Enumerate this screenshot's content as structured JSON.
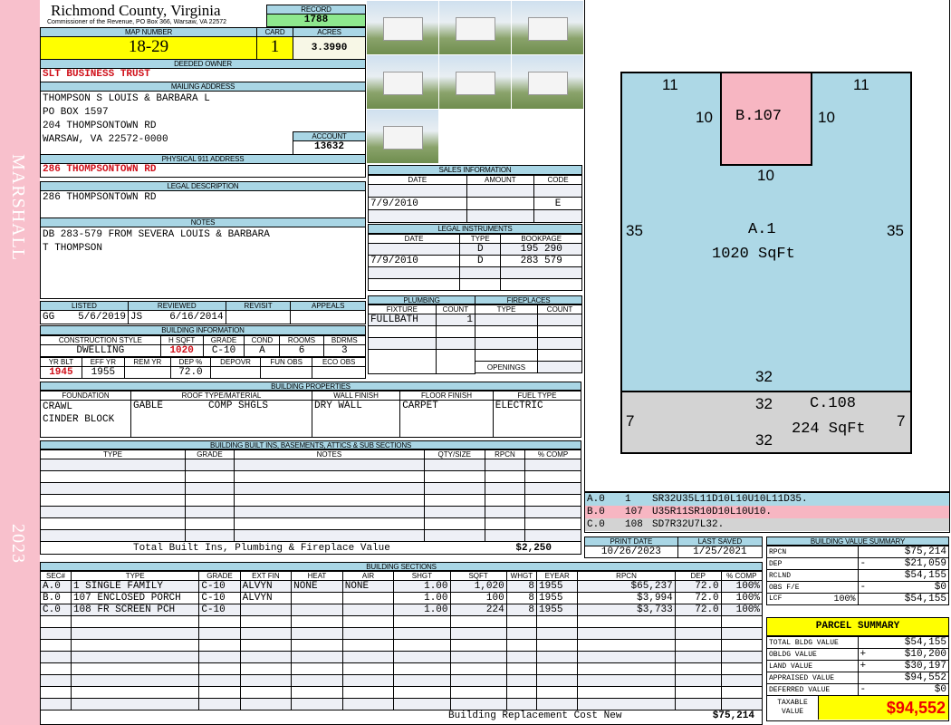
{
  "side": {
    "district": "MARSHALL",
    "year": "2023"
  },
  "header": {
    "county": "Richmond County, Virginia",
    "subtitle": "Commissioner of the Revenue, PO Box 366, Warsaw, VA 22572",
    "record_label": "RECORD",
    "record": "1788",
    "map_label": "MAP NUMBER",
    "map": "18-29",
    "card_label": "CARD",
    "card": "1",
    "acres_label": "ACRES",
    "acres": "3.3990"
  },
  "owner": {
    "label": "DEEDED OWNER",
    "value": "SLT BUSINESS TRUST"
  },
  "mailing": {
    "label": "MAILING ADDRESS",
    "lines": [
      "THOMPSON S LOUIS & BARBARA L",
      "PO BOX 1597",
      "204 THOMPSONTOWN RD",
      "WARSAW, VA 22572-0000"
    ],
    "account_label": "ACCOUNT",
    "account": "13632"
  },
  "physical": {
    "label": "PHYSICAL 911 ADDRESS",
    "value": "286 THOMPSONTOWN RD"
  },
  "legal": {
    "label": "LEGAL DESCRIPTION",
    "value": "286 THOMPSONTOWN RD"
  },
  "notes": {
    "label": "NOTES",
    "lines": [
      "DB 283-579 FROM SEVERA LOUIS & BARBARA",
      "T THOMPSON"
    ]
  },
  "sales": {
    "label": "SALES INFORMATION",
    "cols": [
      "DATE",
      "AMOUNT",
      "CODE"
    ],
    "rows": [
      [
        "",
        "",
        ""
      ],
      [
        "7/9/2010",
        "",
        "E"
      ],
      [
        "",
        "",
        ""
      ]
    ]
  },
  "instruments": {
    "label": "LEGAL INSTRUMENTS",
    "cols": [
      "DATE",
      "TYPE",
      "BOOKPAGE"
    ],
    "rows": [
      [
        "",
        "D",
        "195 290"
      ],
      [
        "7/9/2010",
        "D",
        "283 579"
      ],
      [
        "",
        "",
        ""
      ],
      [
        "",
        "",
        ""
      ]
    ]
  },
  "review": {
    "cols": [
      "LISTED",
      "REVIEWED",
      "REVISIT",
      "APPEALS"
    ],
    "listed_by": "GG",
    "listed": "5/6/2019",
    "reviewed_by": "JS",
    "reviewed": "6/16/2014"
  },
  "building": {
    "label": "BUILDING INFORMATION",
    "cols1": [
      "CONSTRUCTION STYLE",
      "H SQFT",
      "GRADE",
      "COND",
      "ROOMS",
      "BDRMS"
    ],
    "vals1": [
      "DWELLING",
      "1020",
      "C-10",
      "A",
      "6",
      "3"
    ],
    "cols2": [
      "YR BLT",
      "EFF YR",
      "REM YR",
      "DEP %",
      "DEPOVR",
      "FUN OBS",
      "ECO OBS"
    ],
    "vals2": [
      "1945",
      "1955",
      "",
      "72.0",
      "",
      "",
      ""
    ]
  },
  "plumbing": {
    "label": "PLUMBING",
    "cols": [
      "FIXTURE",
      "COUNT"
    ],
    "rows": [
      [
        "FULLBATH",
        "1"
      ]
    ]
  },
  "fireplaces": {
    "label": "FIREPLACES",
    "cols": [
      "TYPE",
      "COUNT"
    ],
    "openings": "OPENINGS"
  },
  "properties": {
    "label": "BUILDING PROPERTIES",
    "cols": [
      "FOUNDATION",
      "ROOF TYPE/MATERIAL",
      "WALL FINISH",
      "FLOOR FINISH",
      "FUEL TYPE"
    ],
    "foundation": [
      "CRAWL",
      "CINDER BLOCK"
    ],
    "roof_type": "GABLE",
    "roof_material": "COMP SHGLS",
    "wall": "DRY WALL",
    "floor": "CARPET",
    "fuel": "ELECTRIC"
  },
  "builtins": {
    "label": "BUILDING BUILT INS, BASEMENTS, ATTICS & SUB SECTIONS",
    "cols": [
      "TYPE",
      "GRADE",
      "NOTES",
      "QTY/SIZE",
      "RPCN",
      "% COMP"
    ],
    "total_label": "Total Built Ins, Plumbing & Fireplace Value",
    "total": "$2,250"
  },
  "sketch": {
    "a_label": "A.1",
    "a_area": "1020 SqFt",
    "b_label": "B.107",
    "c_label": "C.108",
    "c_area": "224 SqFt",
    "dims": {
      "top_left": "11",
      "top_right": "11",
      "b_left": "10",
      "b_right": "10",
      "b_bottom": "10",
      "a_left": "35",
      "a_right": "35",
      "a_bottom": "32",
      "c_top": "32",
      "c_bottom": "32",
      "c_left": "7",
      "c_right": "7"
    },
    "colors": {
      "a": "#add8e6",
      "b": "#f7b6c2",
      "c": "#d3d3d3"
    }
  },
  "codes": [
    {
      "sec": "A.0",
      "code": "1",
      "path": "SR32U35L11D10L10U10L11D35."
    },
    {
      "sec": "B.0",
      "code": "107",
      "path": "U35R11SR10D10L10U10."
    },
    {
      "sec": "C.0",
      "code": "108",
      "path": "SD7R32U7L32."
    }
  ],
  "dates": {
    "print_label": "PRINT DATE",
    "print": "10/26/2023",
    "saved_label": "LAST SAVED",
    "saved": "1/25/2021"
  },
  "sections": {
    "label": "BUILDING SECTIONS",
    "cols": [
      "SEC#",
      "TYPE",
      "GRADE",
      "EXT FIN",
      "HEAT",
      "AIR",
      "SHGT",
      "SQFT",
      "WHGT",
      "EYEAR",
      "RPCN",
      "DEP",
      "% COMP"
    ],
    "rows": [
      [
        "A.0",
        "1 SINGLE FAMILY",
        "C-10",
        "ALVYN",
        "NONE",
        "NONE",
        "1.00",
        "1,020",
        "8",
        "1955",
        "$65,237",
        "72.0",
        "100%"
      ],
      [
        "B.0",
        "107 ENCLOSED PORCH",
        "C-10",
        "ALVYN",
        "",
        "",
        "1.00",
        "100",
        "8",
        "1955",
        "$3,994",
        "72.0",
        "100%"
      ],
      [
        "C.0",
        "108 FR SCREEN PCH",
        "C-10",
        "",
        "",
        "",
        "1.00",
        "224",
        "8",
        "1955",
        "$3,733",
        "72.0",
        "100%"
      ]
    ],
    "total_label": "Building Replacement Cost New",
    "total": "$75,214"
  },
  "value_summary": {
    "label": "BUILDING VALUE SUMMARY",
    "rows": [
      {
        "k": "RPCN",
        "s": "",
        "v": "$75,214"
      },
      {
        "k": "DEP",
        "s": "-",
        "v": "$21,059"
      },
      {
        "k": "RCLND",
        "s": "",
        "v": "$54,155"
      },
      {
        "k": "OBS F/E",
        "s": "-",
        "v": "$0"
      },
      {
        "k": "LCF",
        "pct": "100%",
        "s": "",
        "v": "$54,155"
      }
    ]
  },
  "parcel": {
    "label": "PARCEL SUMMARY",
    "rows": [
      {
        "k": "TOTAL BLDG VALUE",
        "s": "",
        "v": "$54,155"
      },
      {
        "k": "OBLDG VALUE",
        "s": "+",
        "v": "$10,200"
      },
      {
        "k": "LAND VALUE",
        "s": "+",
        "v": "$30,197"
      },
      {
        "k": "APPRAISED VALUE",
        "s": "",
        "v": "$94,552"
      },
      {
        "k": "DEFERRED VALUE",
        "s": "-",
        "v": "$0"
      }
    ],
    "taxable_label": "TAXABLE VALUE",
    "taxable": "$94,552"
  }
}
